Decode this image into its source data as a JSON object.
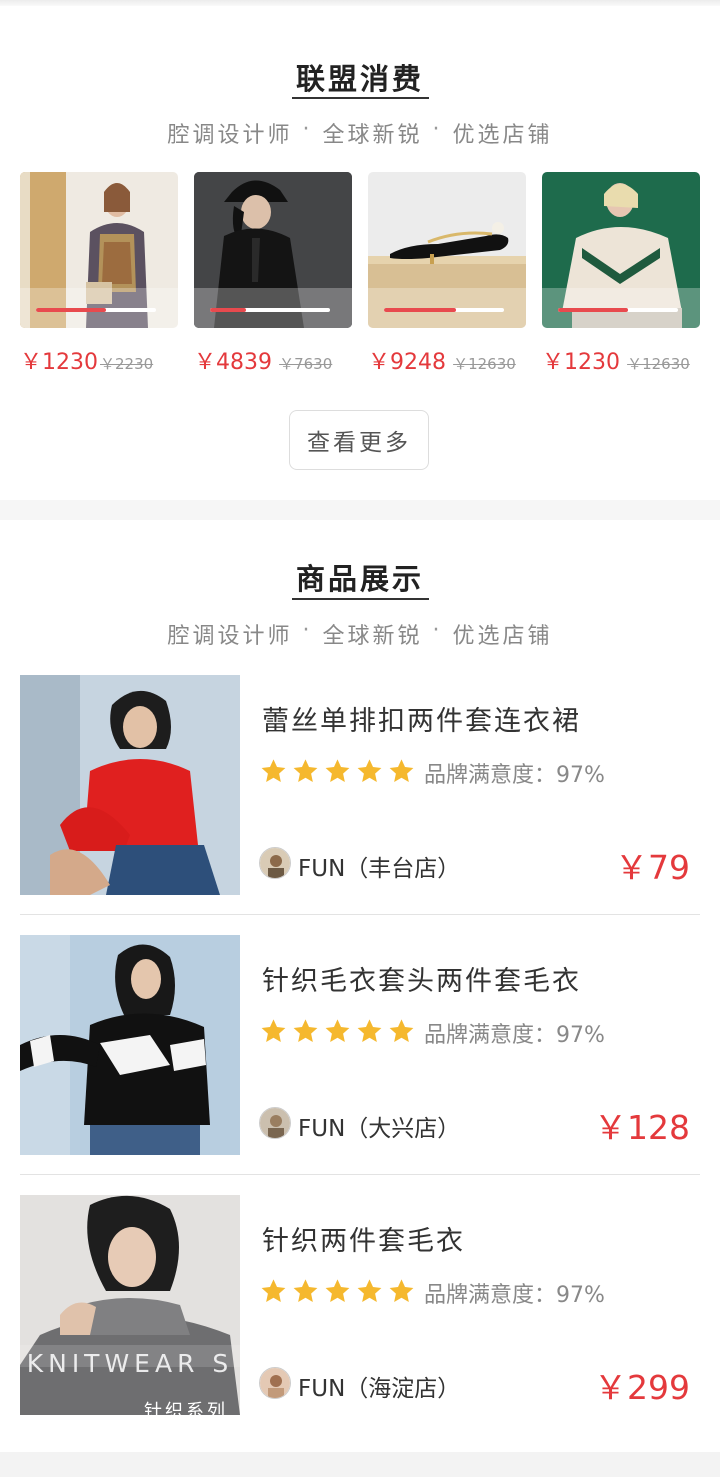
{
  "alliance": {
    "title": "联盟消费",
    "subtitle": [
      "腔调设计师",
      "·",
      "全球新锐",
      "·",
      "优选店铺"
    ],
    "items": [
      {
        "price": "￥1230",
        "original": "￥2230",
        "progress": 0.58
      },
      {
        "price": "￥4839",
        "original": "￥7630",
        "progress": 0.3
      },
      {
        "price": "￥9248",
        "original": "￥12630",
        "progress": 0.6
      },
      {
        "price": "￥1230",
        "original": "￥12630",
        "progress": 0.58
      }
    ],
    "more_label": "查看更多"
  },
  "showcase": {
    "title": "商品展示",
    "subtitle": [
      "腔调设计师",
      "·",
      "全球新锐",
      "·",
      "优选店铺"
    ],
    "products": [
      {
        "name": "蕾丝单排扣两件套连衣裙",
        "rating": "品牌满意度：97%",
        "store": "FUN（丰台店）",
        "price": "￥79",
        "stars": 5
      },
      {
        "name": "针织毛衣套头两件套毛衣",
        "rating": "品牌满意度：97%",
        "store": "FUN（大兴店）",
        "price": "￥128",
        "stars": 5
      },
      {
        "name": "针织两件套毛衣",
        "rating": "品牌满意度：97%",
        "store": "FUN（海淀店）",
        "price": "￥299",
        "stars": 5
      }
    ],
    "image_overlay": {
      "knitwear": "KNITWEAR S",
      "series": "针织系列"
    }
  },
  "colors": {
    "accent": "#e4393c",
    "star": "#f5b82e"
  }
}
